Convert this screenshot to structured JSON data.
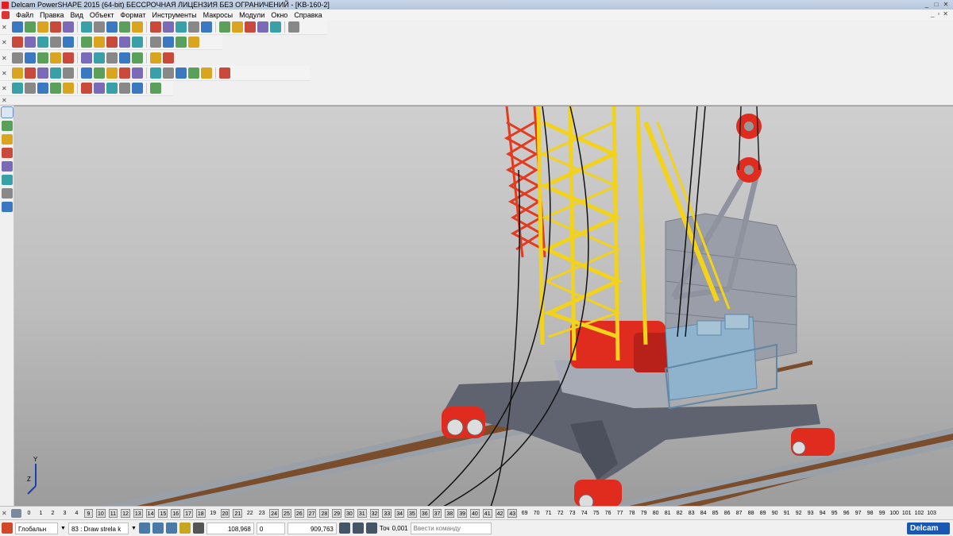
{
  "window": {
    "title": "Delcam PowerSHAPE 2015 (64-bit) БЕССРОЧНАЯ ЛИЦЕНЗИЯ БЕЗ ОГРАНИЧЕНИЙ - [KB-160-2]",
    "controls": [
      "_",
      "□",
      "✕"
    ],
    "mdi_controls": [
      "_",
      "▫",
      "✕"
    ]
  },
  "menu": [
    "Файл",
    "Правка",
    "Вид",
    "Объект",
    "Формат",
    "Инструменты",
    "Макросы",
    "Модули",
    "Окно",
    "Справка"
  ],
  "toolbars": [
    {
      "name": "main-toolbar",
      "icons": [
        "new-icon",
        "open-icon",
        "save-icon",
        "save-as-icon",
        "print-icon",
        "cut-icon",
        "copy-icon",
        "paste-icon",
        "delete-icon",
        "undo-icon",
        "redo-icon",
        "select-icon",
        "line-icon",
        "arc-icon",
        "circle-icon",
        "curve-icon",
        "text-icon",
        "solid-icon",
        "surface-icon",
        "mesh-icon",
        "tools-icon"
      ]
    },
    {
      "name": "view-toolbar",
      "icons": [
        "view-front-icon",
        "view-back-icon",
        "view-top-icon",
        "view-iso-icon",
        "rotate-icon",
        "pan-icon",
        "zoom-in-icon",
        "zoom-out-icon",
        "zoom-all-icon",
        "zoom-window-icon",
        "shade-icon",
        "wireframe-icon",
        "lights-icon",
        "hide-icon"
      ]
    },
    {
      "name": "attributes-toolbar",
      "icons": [
        "layer-icon",
        "color-icon",
        "material-icon",
        "sphere-icon",
        "cube-icon",
        "cone-icon",
        "torus-icon",
        "measure-icon",
        "dim-icon",
        "analysis-icon",
        "align-icon",
        "transform-icon"
      ]
    },
    {
      "name": "solid-toolbar",
      "icons": [
        "solid-box-icon",
        "solid-cyl-icon",
        "extrude-icon",
        "revolve-icon",
        "boolean-add-icon",
        "boolean-sub-icon",
        "fillet-icon",
        "chamfer-icon",
        "shell-icon",
        "draft-icon",
        "pattern-icon",
        "mirror-icon",
        "feature-tree-icon",
        "history-icon",
        "sketch-icon",
        "blend-icon"
      ]
    },
    {
      "name": "workplane-toolbar",
      "icons": [
        "workplane-icon",
        "axis-icon",
        "move-icon",
        "copy-multi-icon",
        "rotate-obj-icon",
        "scale-icon",
        "offset-icon",
        "project-icon",
        "group-icon",
        "ungroup-icon",
        "assemble-icon"
      ]
    }
  ],
  "left_panel": {
    "icons": [
      "arrow-select-icon",
      "multi-select-icon",
      "axis-x-icon",
      "axis-y-icon",
      "sphere-snap-icon",
      "plane-icon",
      "axis-z-icon",
      "node-icon"
    ]
  },
  "viewport": {
    "axis_labels": {
      "y": "Y",
      "z": "Z"
    },
    "colors": {
      "boom_yellow": "#f2d21b",
      "mast_red": "#e23b20",
      "carriage_red": "#e02b1f",
      "frame_grey": "#6b6f7a",
      "counterweight_grey": "#9a9ea8",
      "cabin_blue": "#8fb3cc",
      "rail_brown": "#7a4e2c",
      "rail_steel": "#9aa0a8"
    }
  },
  "level_bar": {
    "levels": [
      {
        "n": "0",
        "boxed": false
      },
      {
        "n": "1",
        "boxed": false
      },
      {
        "n": "2",
        "boxed": false
      },
      {
        "n": "3",
        "boxed": false
      },
      {
        "n": "4",
        "boxed": false
      },
      {
        "n": "9",
        "boxed": true
      },
      {
        "n": "10",
        "boxed": true
      },
      {
        "n": "11",
        "boxed": true
      },
      {
        "n": "12",
        "boxed": true
      },
      {
        "n": "13",
        "boxed": true
      },
      {
        "n": "14",
        "boxed": true
      },
      {
        "n": "15",
        "boxed": true
      },
      {
        "n": "16",
        "boxed": true
      },
      {
        "n": "17",
        "boxed": true
      },
      {
        "n": "18",
        "boxed": true
      },
      {
        "n": "19",
        "boxed": false
      },
      {
        "n": "20",
        "boxed": true
      },
      {
        "n": "21",
        "boxed": true
      },
      {
        "n": "22",
        "boxed": false
      },
      {
        "n": "23",
        "boxed": false
      },
      {
        "n": "24",
        "boxed": true
      },
      {
        "n": "25",
        "boxed": true
      },
      {
        "n": "26",
        "boxed": true
      },
      {
        "n": "27",
        "boxed": true
      },
      {
        "n": "28",
        "boxed": true
      },
      {
        "n": "29",
        "boxed": true
      },
      {
        "n": "30",
        "boxed": true
      },
      {
        "n": "31",
        "boxed": true
      },
      {
        "n": "32",
        "boxed": true
      },
      {
        "n": "33",
        "boxed": true
      },
      {
        "n": "34",
        "boxed": true
      },
      {
        "n": "35",
        "boxed": true
      },
      {
        "n": "36",
        "boxed": true
      },
      {
        "n": "37",
        "boxed": true
      },
      {
        "n": "38",
        "boxed": true
      },
      {
        "n": "39",
        "boxed": true
      },
      {
        "n": "40",
        "boxed": true
      },
      {
        "n": "41",
        "boxed": true
      },
      {
        "n": "42",
        "boxed": true
      },
      {
        "n": "43",
        "boxed": true
      },
      {
        "n": "69",
        "boxed": false
      },
      {
        "n": "70",
        "boxed": false
      },
      {
        "n": "71",
        "boxed": false
      },
      {
        "n": "72",
        "boxed": false
      },
      {
        "n": "73",
        "boxed": false
      },
      {
        "n": "74",
        "boxed": false
      },
      {
        "n": "75",
        "boxed": false
      },
      {
        "n": "76",
        "boxed": false
      },
      {
        "n": "77",
        "boxed": false
      },
      {
        "n": "78",
        "boxed": false
      },
      {
        "n": "79",
        "boxed": false
      },
      {
        "n": "80",
        "boxed": false
      },
      {
        "n": "81",
        "boxed": false
      },
      {
        "n": "82",
        "boxed": false
      },
      {
        "n": "83",
        "boxed": false
      },
      {
        "n": "84",
        "boxed": false
      },
      {
        "n": "85",
        "boxed": false
      },
      {
        "n": "86",
        "boxed": false
      },
      {
        "n": "87",
        "boxed": false
      },
      {
        "n": "88",
        "boxed": false
      },
      {
        "n": "89",
        "boxed": false
      },
      {
        "n": "90",
        "boxed": false
      },
      {
        "n": "91",
        "boxed": false
      },
      {
        "n": "92",
        "boxed": false
      },
      {
        "n": "93",
        "boxed": false
      },
      {
        "n": "94",
        "boxed": false
      },
      {
        "n": "95",
        "boxed": false
      },
      {
        "n": "96",
        "boxed": false
      },
      {
        "n": "97",
        "boxed": false
      },
      {
        "n": "98",
        "boxed": false
      },
      {
        "n": "99",
        "boxed": false
      },
      {
        "n": "100",
        "boxed": false
      },
      {
        "n": "101",
        "boxed": false
      },
      {
        "n": "102",
        "boxed": false
      },
      {
        "n": "103",
        "boxed": false
      }
    ]
  },
  "status_bar": {
    "workplane": "Глобальн",
    "level_number": "83",
    "level_name": ": Draw strela k",
    "coord_x": "108,968",
    "coord_y": "0",
    "coord_z": "909,763",
    "tolerance_label": "Точ",
    "tolerance_value": "0,001",
    "command_placeholder": "Ввести команду",
    "brand": "Delcam"
  }
}
